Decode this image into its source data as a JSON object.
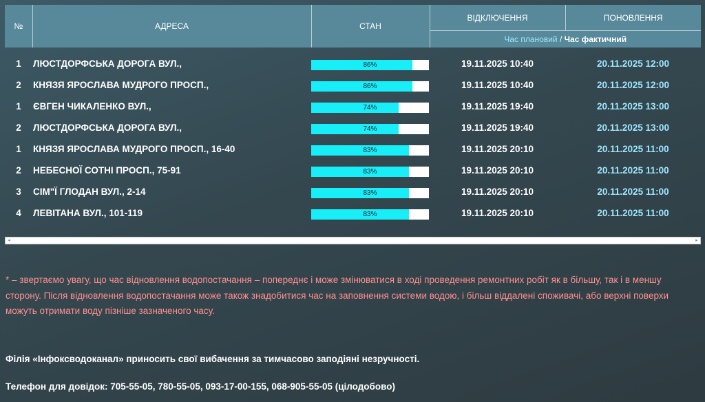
{
  "header": {
    "num": "№",
    "address": "АДРЕСА",
    "status": "СТАН",
    "shutdown": "ВІДКЛЮЧЕННЯ",
    "restore": "ПОНОВЛЕННЯ",
    "time_planned": "Час плановий",
    "time_separator": " / ",
    "time_actual": "Час фактичний"
  },
  "colors": {
    "header_bg": "#57899b",
    "progress_fill": "#17eef7",
    "restore_text": "#9fe6ff",
    "notice_text": "#ff8f8f"
  },
  "rows": [
    {
      "num": "1",
      "address": "ЛЮСТДОРФСЬКА ДОРОГА ВУЛ.,",
      "progress": 86,
      "progress_label": "86%",
      "shutdown": "19.11.2025 10:40",
      "restore": "20.11.2025 12:00"
    },
    {
      "num": "2",
      "address": "КНЯЗЯ ЯРОСЛАВА МУДРОГО ПРОСП.,",
      "progress": 86,
      "progress_label": "86%",
      "shutdown": "19.11.2025 10:40",
      "restore": "20.11.2025 12:00"
    },
    {
      "num": "1",
      "address": "ЄВГЕН ЧИКАЛЕНКО ВУЛ.,",
      "progress": 74,
      "progress_label": "74%",
      "shutdown": "19.11.2025 19:40",
      "restore": "20.11.2025 13:00"
    },
    {
      "num": "2",
      "address": "ЛЮСТДОРФСЬКА ДОРОГА ВУЛ.,",
      "progress": 74,
      "progress_label": "74%",
      "shutdown": "19.11.2025 19:40",
      "restore": "20.11.2025 13:00"
    },
    {
      "num": "1",
      "address": "КНЯЗЯ ЯРОСЛАВА МУДРОГО ПРОСП., 16-40",
      "progress": 83,
      "progress_label": "83%",
      "shutdown": "19.11.2025 20:10",
      "restore": "20.11.2025 11:00"
    },
    {
      "num": "2",
      "address": "НЕБЕСНОЇ СОТНІ ПРОСП., 75-91",
      "progress": 83,
      "progress_label": "83%",
      "shutdown": "19.11.2025 20:10",
      "restore": "20.11.2025 11:00"
    },
    {
      "num": "3",
      "address": "СІМ\"Ї ГЛОДАН ВУЛ., 2-14",
      "progress": 83,
      "progress_label": "83%",
      "shutdown": "19.11.2025 20:10",
      "restore": "20.11.2025 11:00"
    },
    {
      "num": "4",
      "address": "ЛЕВІТАНА ВУЛ., 101-119",
      "progress": 83,
      "progress_label": "83%",
      "shutdown": "19.11.2025 20:10",
      "restore": "20.11.2025 11:00"
    }
  ],
  "scrollbar": {
    "left_arrow_icon": "arrow-left-icon",
    "right_arrow_icon": "arrow-right-icon"
  },
  "notice": {
    "line1": "* – звертаємо увагу, що час відновлення водопостачання – попереднє і може змінюватися в ході проведення ремонтних робіт як в більшу, так і в меншу",
    "line2": "сторону. Після відновлення водопостачання може також знадобитися час на заповнення системи водою, і більш віддалені споживачі, або верхні поверхи",
    "line3": "можуть отримати воду пізніше зазначеного часу."
  },
  "apology": "Філія «Інфоксводоканал» приносить свої вибачення за тимчасово заподіяні незручності.",
  "phones": "Телефон для довідок: 705-55-05, 780-55-05, 093-17-00-155, 068-905-55-05 (цілодобово)"
}
